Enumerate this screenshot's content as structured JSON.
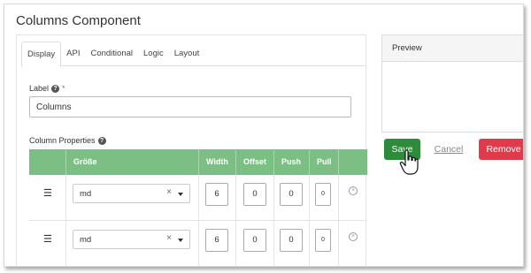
{
  "modal": {
    "title": "Columns Component"
  },
  "tabs": [
    {
      "label": "Display"
    },
    {
      "label": "API"
    },
    {
      "label": "Conditional"
    },
    {
      "label": "Logic"
    },
    {
      "label": "Layout"
    }
  ],
  "label_field": {
    "label": "Label",
    "required_mark": "*",
    "value": "Columns",
    "help": "?"
  },
  "column_properties": {
    "label": "Column Properties",
    "help": "?"
  },
  "grid": {
    "headers": [
      "Größe",
      "Width",
      "Offset",
      "Push",
      "Pull"
    ],
    "rows": [
      {
        "size": "md",
        "width": "6",
        "offset": "0",
        "push": "0",
        "pull": "0"
      },
      {
        "size": "md",
        "width": "6",
        "offset": "0",
        "push": "0",
        "pull": "0"
      }
    ],
    "header_color": "#7cbf85"
  },
  "preview": {
    "title": "Preview"
  },
  "buttons": {
    "save": "Save",
    "cancel": "Cancel",
    "remove": "Remove"
  },
  "colors": {
    "save": "#2e8b3c",
    "remove": "#e03b4b"
  },
  "icons": {
    "drag": "bars-icon",
    "clear": "times-icon",
    "caret": "caret-down-icon",
    "remove_row": "times-circle-icon",
    "help": "question-circle-icon",
    "cursor": "hand-pointer-icon"
  }
}
